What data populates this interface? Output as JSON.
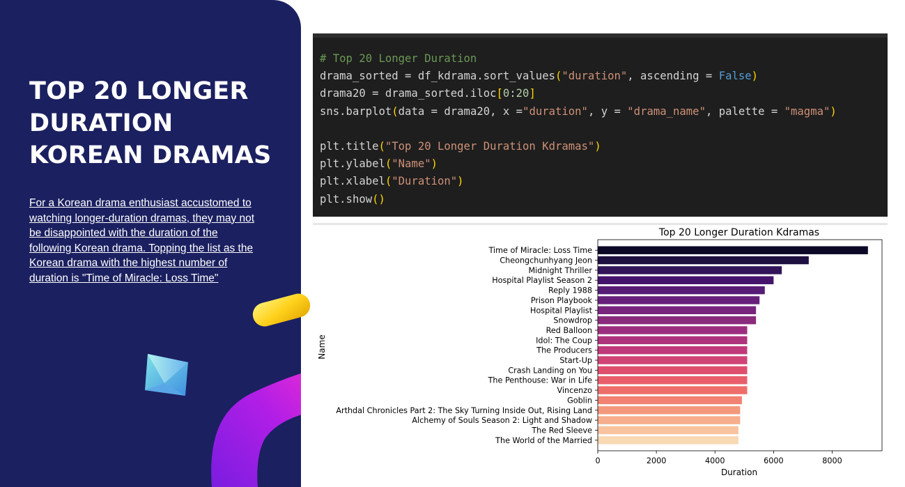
{
  "slide": {
    "title_lines": [
      "TOP 20 LONGER",
      "DURATION",
      "KOREAN DRAMAS"
    ],
    "description": "For a Korean drama enthusiast accustomed to watching longer-duration dramas, they may not be disappointed with the duration of the following Korean drama. Topping the list as the Korean drama with the highest number of duration is \"Time of Miracle: Loss Time\""
  },
  "code": {
    "lines": [
      [
        [
          "com",
          "# Top 20 Longer Duration"
        ]
      ],
      [
        [
          "txt",
          "drama_sorted = df_kdrama.sort_values"
        ],
        [
          "br",
          "("
        ],
        [
          "str",
          "\"duration\""
        ],
        [
          "txt",
          ", ascending = "
        ],
        [
          "kw",
          "False"
        ],
        [
          "br",
          ")"
        ]
      ],
      [
        [
          "txt",
          "drama20 = drama_sorted.iloc"
        ],
        [
          "br",
          "["
        ],
        [
          "num",
          "0"
        ],
        [
          "txt",
          ":"
        ],
        [
          "num",
          "20"
        ],
        [
          "br",
          "]"
        ]
      ],
      [
        [
          "txt",
          "sns.barplot"
        ],
        [
          "br",
          "("
        ],
        [
          "txt",
          "data = drama20, x ="
        ],
        [
          "str",
          "\"duration\""
        ],
        [
          "txt",
          ", y = "
        ],
        [
          "str",
          "\"drama_name\""
        ],
        [
          "txt",
          ", palette = "
        ],
        [
          "str",
          "\"magma\""
        ],
        [
          "br",
          ")"
        ]
      ],
      [],
      [
        [
          "txt",
          "plt.title"
        ],
        [
          "br",
          "("
        ],
        [
          "str",
          "\"Top 20 Longer Duration Kdramas\""
        ],
        [
          "br",
          ")"
        ]
      ],
      [
        [
          "txt",
          "plt.ylabel"
        ],
        [
          "br",
          "("
        ],
        [
          "str",
          "\"Name\""
        ],
        [
          "br",
          ")"
        ]
      ],
      [
        [
          "txt",
          "plt.xlabel"
        ],
        [
          "br",
          "("
        ],
        [
          "str",
          "\"Duration\""
        ],
        [
          "br",
          ")"
        ]
      ],
      [
        [
          "txt",
          "plt.show"
        ],
        [
          "br",
          "()"
        ]
      ]
    ]
  },
  "chart_data": {
    "type": "bar",
    "orientation": "horizontal",
    "title": "Top 20 Longer Duration Kdramas",
    "xlabel": "Duration",
    "ylabel": "Name",
    "xlim": [
      0,
      9700
    ],
    "xticks": [
      0,
      2000,
      4000,
      6000,
      8000
    ],
    "palette": "magma",
    "categories": [
      "Time of Miracle: Loss Time",
      "Cheongchunhyang Jeon",
      "Midnight Thriller",
      "Hospital Playlist Season 2",
      "Reply 1988",
      "Prison Playbook",
      "Hospital Playlist",
      "Snowdrop",
      "Red Balloon",
      "Idol: The Coup",
      "The Producers",
      "Start-Up",
      "Crash Landing on You",
      "The Penthouse: War in Life",
      "Vincenzo",
      "Goblin",
      "Arthdal Chronicles Part 2: The Sky Turning Inside Out, Rising Land",
      "Alchemy of Souls Season 2: Light and Shadow",
      "The Red Sleeve",
      "The World of the Married"
    ],
    "values": [
      9220,
      7200,
      6280,
      6000,
      5700,
      5520,
      5400,
      5400,
      5100,
      5100,
      5100,
      5100,
      5100,
      5100,
      5100,
      4920,
      4860,
      4860,
      4800,
      4800
    ],
    "colors": [
      "#0c0927",
      "#1e1040",
      "#311459",
      "#44146c",
      "#571c75",
      "#67217b",
      "#78257e",
      "#8a2b7e",
      "#9c2e7f",
      "#ae337d",
      "#c0397a",
      "#d04375",
      "#de4f6e",
      "#e85f6b",
      "#ee6e6a",
      "#f18271",
      "#f4987c",
      "#f6ae8c",
      "#f8c39e",
      "#f9d8b4"
    ]
  }
}
